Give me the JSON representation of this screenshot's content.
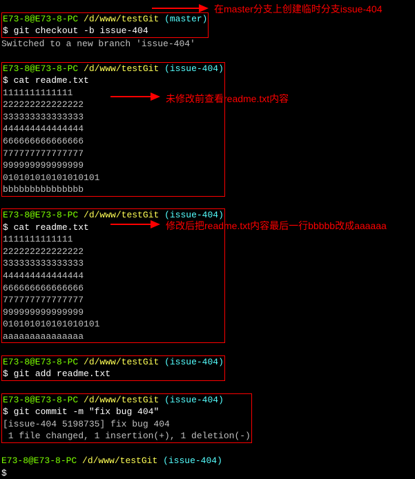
{
  "block1": {
    "prompt_user": "E73-8@E73-8-PC",
    "prompt_path": "/d/www/testGit",
    "prompt_branch": "(master)",
    "dollar": "$",
    "cmd": "git checkout -b issue-404",
    "out": "Switched to a new branch 'issue-404'"
  },
  "block2": {
    "prompt_user": "E73-8@E73-8-PC",
    "prompt_path": "/d/www/testGit",
    "prompt_branch": "(issue-404)",
    "dollar": "$",
    "cmd": "cat readme.txt",
    "l1": "1111111111111",
    "l2": "222222222222222",
    "l3": "333333333333333",
    "l4": "444444444444444",
    "l5": "666666666666666",
    "l6": "777777777777777",
    "l7": "999999999999999",
    "l8": "010101010101010101",
    "l9": "bbbbbbbbbbbbbbb"
  },
  "block3": {
    "prompt_user": "E73-8@E73-8-PC",
    "prompt_path": "/d/www/testGit",
    "prompt_branch": "(issue-404)",
    "dollar": "$",
    "cmd": "cat readme.txt",
    "l1": "1111111111111",
    "l2": "222222222222222",
    "l3": "333333333333333",
    "l4": "444444444444444",
    "l5": "666666666666666",
    "l6": "777777777777777",
    "l7": "999999999999999",
    "l8": "010101010101010101",
    "l9": "aaaaaaaaaaaaaaa"
  },
  "block4": {
    "prompt_user": "E73-8@E73-8-PC",
    "prompt_path": "/d/www/testGit",
    "prompt_branch": "(issue-404)",
    "dollar": "$",
    "cmd": "git add readme.txt"
  },
  "block5": {
    "prompt_user": "E73-8@E73-8-PC",
    "prompt_path": "/d/www/testGit",
    "prompt_branch": "(issue-404)",
    "dollar": "$",
    "cmd": "git commit -m \"fix bug 404\"",
    "o1": "[issue-404 5198735] fix bug 404",
    "o2": " 1 file changed, 1 insertion(+), 1 deletion(-)"
  },
  "block6": {
    "prompt_user": "E73-8@E73-8-PC",
    "prompt_path": "/d/www/testGit",
    "prompt_branch": "(issue-404)",
    "dollar": "$"
  },
  "anno": {
    "a1": "在master分支上创建临时分支issue-404",
    "a2": "未修改前查看readme.txt内容",
    "a3": "修改后把readme.txt内容最后一行bbbbb改成aaaaaa"
  }
}
